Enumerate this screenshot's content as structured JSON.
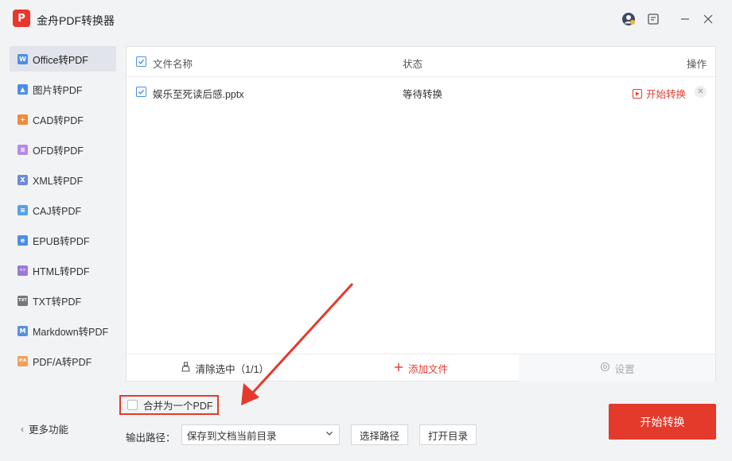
{
  "app": {
    "logo_text": "P",
    "title": "金舟PDF转换器"
  },
  "sidebar": {
    "items": [
      {
        "label": "Office转PDF",
        "icon": "word-icon",
        "glyph": "W",
        "color": "#4a8fe6",
        "active": true
      },
      {
        "label": "图片转PDF",
        "icon": "image-icon",
        "glyph": "▲",
        "color": "#4a8fe6",
        "active": false
      },
      {
        "label": "CAD转PDF",
        "icon": "cad-icon",
        "glyph": "+",
        "color": "#f08a3e",
        "active": false
      },
      {
        "label": "OFD转PDF",
        "icon": "ofd-icon",
        "glyph": "≡",
        "color": "#b58be6",
        "active": false
      },
      {
        "label": "XML转PDF",
        "icon": "xml-icon",
        "glyph": "X",
        "color": "#6e8bd6",
        "active": false
      },
      {
        "label": "CAJ转PDF",
        "icon": "caj-icon",
        "glyph": "≡",
        "color": "#5aa0e8",
        "active": false
      },
      {
        "label": "EPUB转PDF",
        "icon": "epub-icon",
        "glyph": "e",
        "color": "#4a8fe6",
        "active": false
      },
      {
        "label": "HTML转PDF",
        "icon": "html-icon",
        "glyph": "<>",
        "color": "#9a7ad8",
        "active": false
      },
      {
        "label": "TXT转PDF",
        "icon": "txt-icon",
        "glyph": "TXT",
        "color": "#777777",
        "active": false
      },
      {
        "label": "Markdown转PDF",
        "icon": "markdown-icon",
        "glyph": "M",
        "color": "#5a8fe0",
        "active": false
      },
      {
        "label": "PDF/A转PDF",
        "icon": "pdfa-icon",
        "glyph": "P/A",
        "color": "#f0a05a",
        "active": false
      }
    ],
    "more_label": "更多功能"
  },
  "table": {
    "headers": {
      "name": "文件名称",
      "status": "状态",
      "action": "操作"
    },
    "rows": [
      {
        "name": "娱乐至死读后感.pptx",
        "status": "等待转换",
        "action": "开始转换"
      }
    ]
  },
  "footer": {
    "clear_label": "清除选中（1/1）",
    "add_label": "添加文件",
    "settings_label": "设置"
  },
  "merge_label": "合并为一个PDF",
  "output": {
    "label": "输出路径：",
    "selected": "保存到文档当前目录",
    "choose_label": "选择路径",
    "open_label": "打开目录"
  },
  "start_button": "开始转换",
  "colors": {
    "accent": "#e33a2c",
    "check_blue": "#4a8fe6"
  }
}
